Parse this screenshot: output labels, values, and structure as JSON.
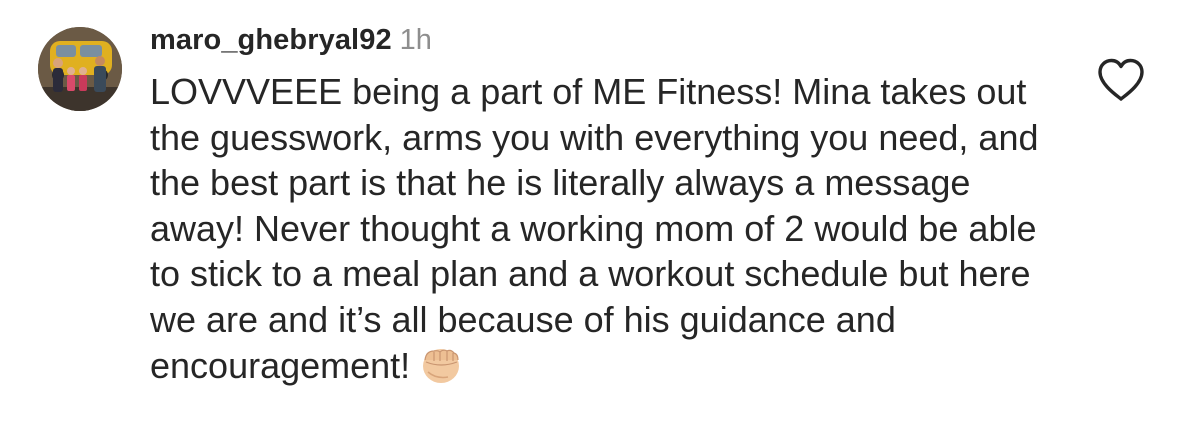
{
  "comment": {
    "username": "maro_ghebryal92",
    "time": "1h",
    "text": "LOVVVEEE being a part of ME Fitness! Mina takes out the guesswork, arms you with everything you need, and the best part is that he is literally always a message away! Never thought a working mom of 2 would be able to stick to a meal plan and a workout schedule but here we are and it’s all because of his guidance and encouragement!",
    "emoji": "fist-bump-emoji",
    "like_icon": "heart-outline-icon",
    "avatar_icon": "family-photo-avatar"
  }
}
